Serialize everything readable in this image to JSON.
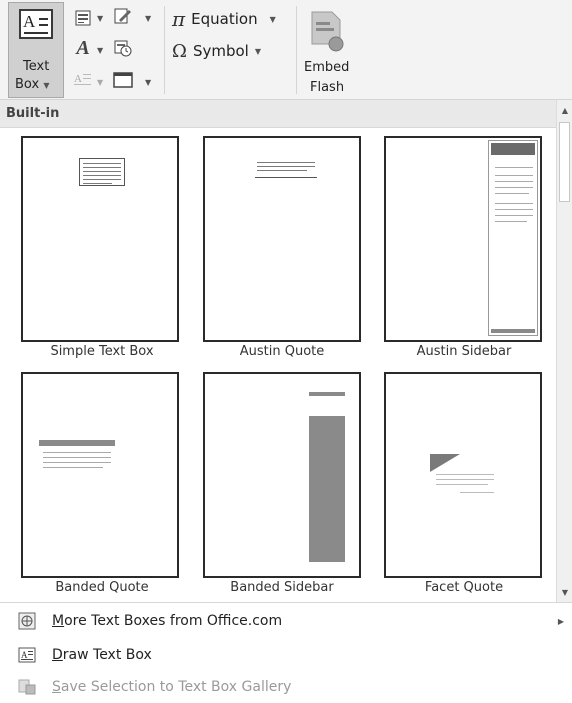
{
  "ribbon": {
    "text_box": {
      "line1": "Text",
      "line2": "Box"
    },
    "equation": {
      "label": "Equation"
    },
    "symbol": {
      "label": "Symbol"
    },
    "embed_flash": {
      "line1": "Embed",
      "line2": "Flash"
    }
  },
  "gallery": {
    "category": "Built-in",
    "items": [
      {
        "label": "Simple Text Box"
      },
      {
        "label": "Austin Quote"
      },
      {
        "label": "Austin Sidebar"
      },
      {
        "label": "Banded Quote"
      },
      {
        "label": "Banded Sidebar"
      },
      {
        "label": "Facet Quote"
      }
    ]
  },
  "menu": {
    "more": {
      "key": "M",
      "rest": "ore Text Boxes from Office.com"
    },
    "draw": {
      "key": "D",
      "rest": "raw Text Box"
    },
    "save": {
      "key": "S",
      "rest": "ave Selection to Text Box Gallery"
    }
  },
  "colors": {
    "ribbon_bg": "#f3f3f3",
    "selected_button": "#d0d0d0",
    "category_header": "#e9e9e9",
    "disabled_text": "#9a9a9a",
    "thumb_grey": "#8a8a8a"
  }
}
